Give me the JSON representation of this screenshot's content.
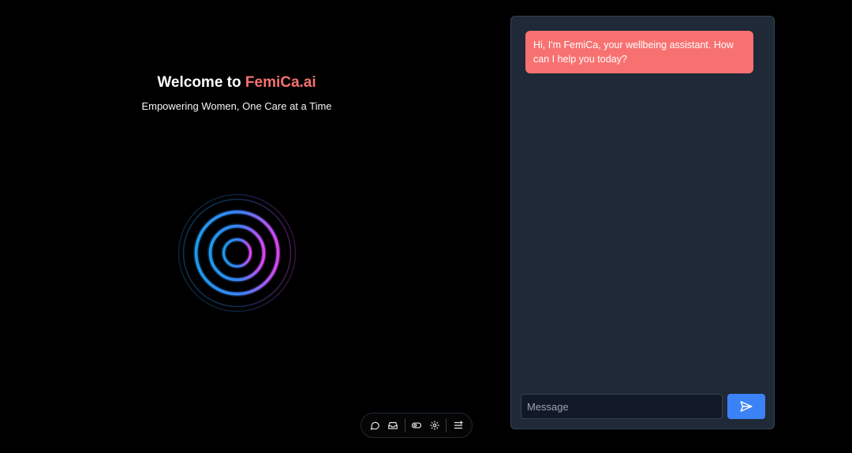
{
  "hero": {
    "title_prefix": "Welcome to",
    "title_brand": "FemiCa.ai",
    "subtitle": "Empowering Women, One Care at a Time"
  },
  "toolbar": {
    "items": [
      {
        "icon": "chat-bubble-icon"
      },
      {
        "icon": "inbox-icon"
      },
      {
        "icon": "toggle-icon"
      },
      {
        "icon": "eye-icon"
      },
      {
        "icon": "menu-lines-icon"
      }
    ]
  },
  "chat": {
    "messages": [
      {
        "role": "assistant",
        "text": "Hi, I'm FemiCa, your wellbeing assistant. How can I help you today?"
      }
    ],
    "input": {
      "placeholder": "Message",
      "value": ""
    },
    "send_icon": "send-icon"
  },
  "colors": {
    "background": "#000000",
    "brand": "#f87171",
    "panel": "#1f2937",
    "input_bg": "#111827",
    "send": "#3b82f6",
    "ring_blue": "#1e9bf0",
    "ring_magenta": "#d946ef"
  }
}
